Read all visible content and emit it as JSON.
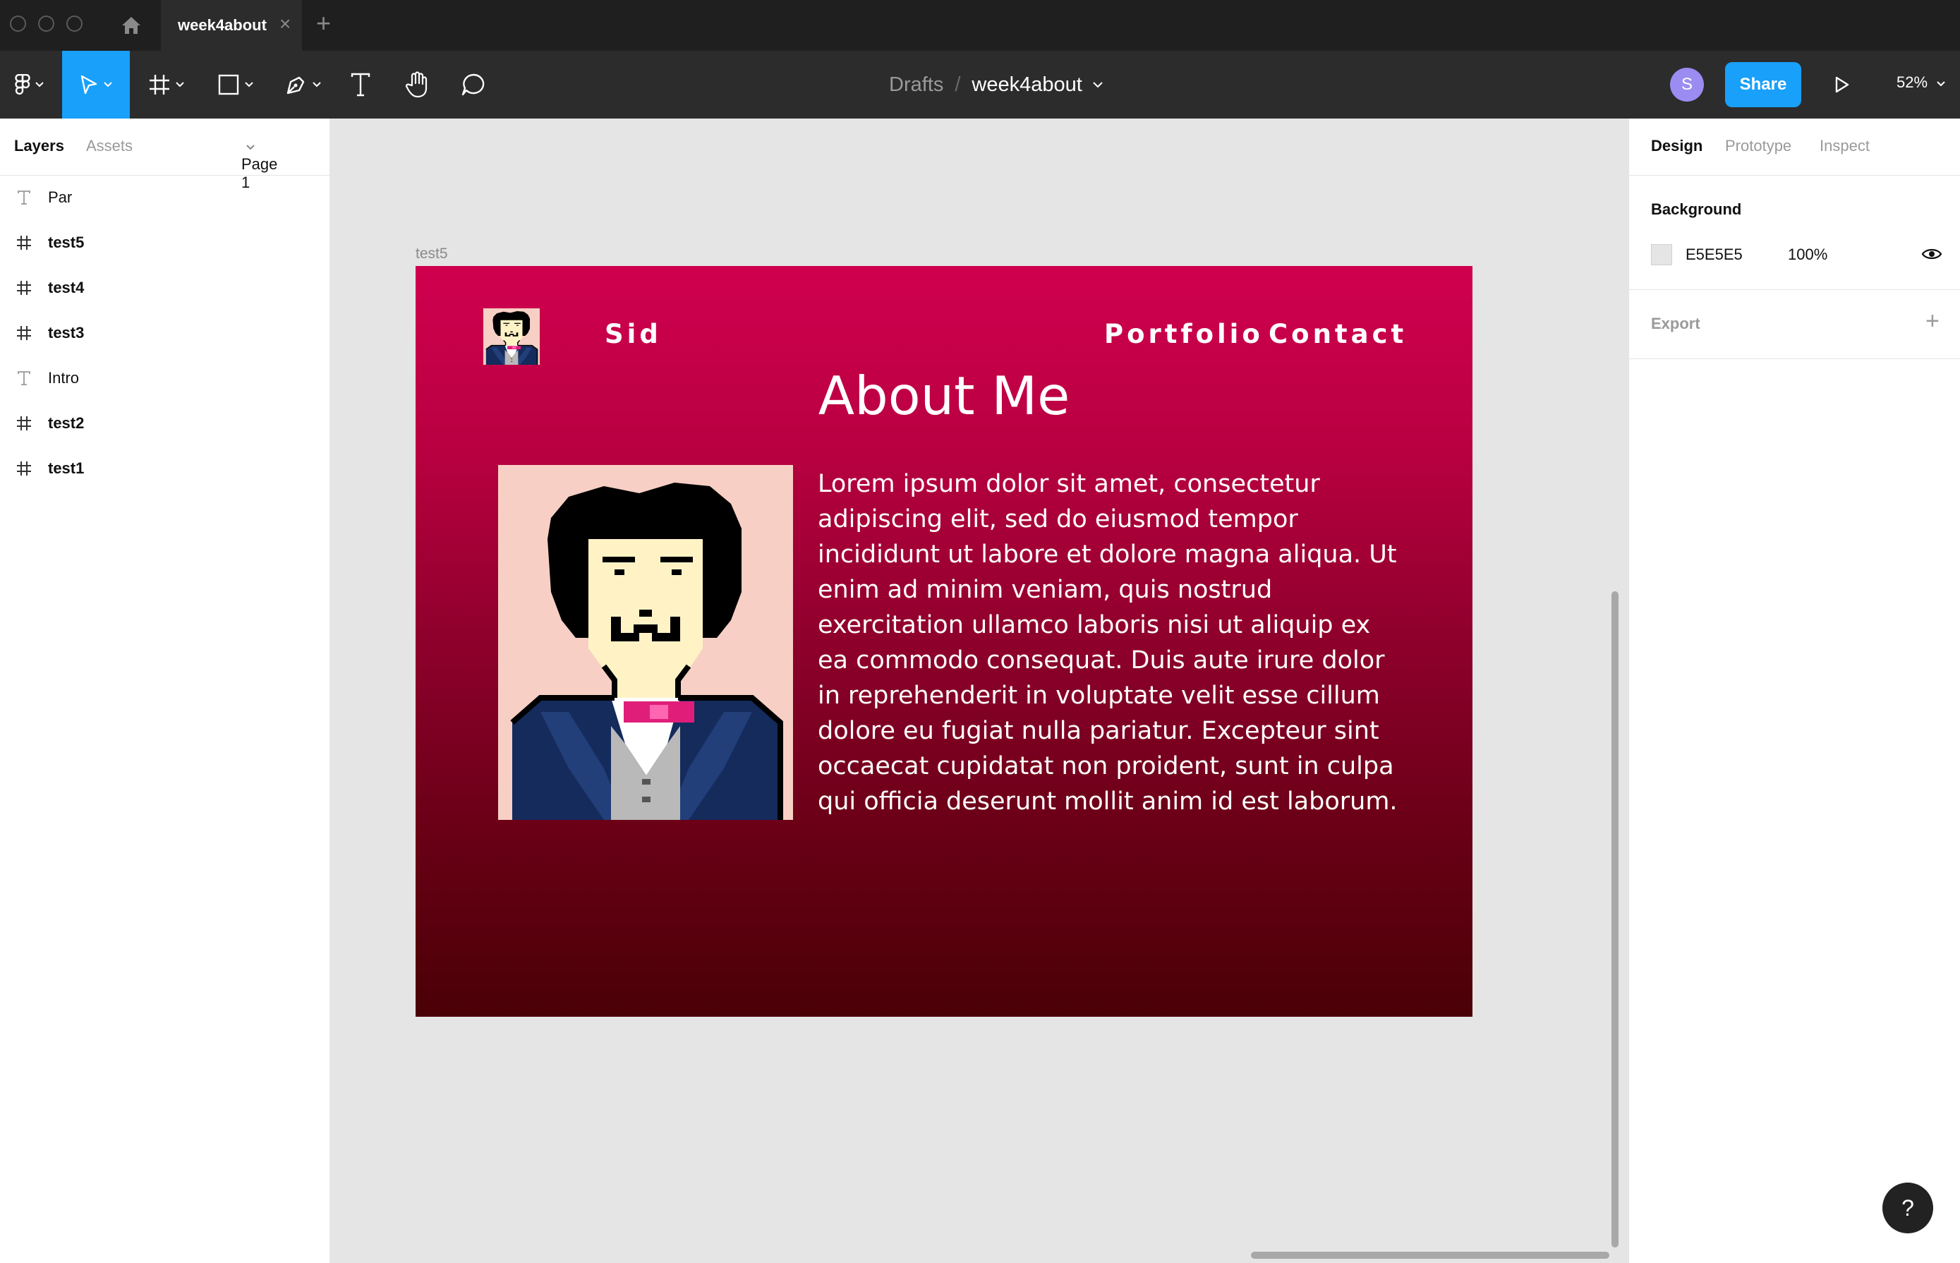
{
  "titlebar": {
    "tab_label": "week4about",
    "tab_close": "×",
    "new_tab": "+"
  },
  "toolbar": {
    "breadcrumb_drafts": "Drafts",
    "breadcrumb_sep": "/",
    "file_name": "week4about",
    "avatar_initial": "S",
    "share_label": "Share",
    "zoom_label": "52%"
  },
  "left_panel": {
    "tabs": {
      "layers": "Layers",
      "assets": "Assets"
    },
    "page_select": "Page 1",
    "layers": [
      {
        "name": "Par",
        "type": "text"
      },
      {
        "name": "test5",
        "type": "frame"
      },
      {
        "name": "test4",
        "type": "frame"
      },
      {
        "name": "test3",
        "type": "frame"
      },
      {
        "name": "Intro",
        "type": "text"
      },
      {
        "name": "test2",
        "type": "frame"
      },
      {
        "name": "test1",
        "type": "frame"
      }
    ]
  },
  "right_panel": {
    "tabs": {
      "design": "Design",
      "prototype": "Prototype",
      "inspect": "Inspect"
    },
    "background_title": "Background",
    "background_hex": "E5E5E5",
    "background_opacity": "100%",
    "export_title": "Export",
    "export_add": "+"
  },
  "canvas": {
    "frame_label": "test5",
    "nav": {
      "name": "Sid",
      "portfolio": "Portfolio",
      "contact": "Contact"
    },
    "heading": "About Me",
    "bio": "Lorem ipsum dolor sit amet, consectetur adipiscing elit, sed do eiusmod tempor incididunt ut labore et dolore magna aliqua. Ut enim ad minim veniam, quis nostrud exercitation ullamco laboris nisi ut aliquip ex ea commodo consequat. Duis aute irure dolor in reprehenderit in voluptate velit esse cillum dolore eu fugiat nulla pariatur. Excepteur sint occaecat cupidatat non proident, sunt in culpa qui officia deserunt mollit anim id est laborum."
  },
  "help_label": "?",
  "colors": {
    "accent": "#18A0FB",
    "toolbar_bg": "#2C2C2C",
    "titlebar_bg": "#1F1F1F",
    "canvas_bg": "#E5E5E5",
    "frame_gradient_top": "#D0004F",
    "frame_gradient_bottom": "#4A0006"
  },
  "icons": {
    "home": "home-icon",
    "figma_menu": "figma-logo-icon",
    "move": "move-tool-icon",
    "frame": "frame-tool-icon",
    "shape": "rectangle-tool-icon",
    "pen": "pen-tool-icon",
    "text": "text-tool-icon",
    "hand": "hand-tool-icon",
    "comment": "comment-tool-icon",
    "play": "present-play-icon",
    "eye": "eye-icon"
  }
}
